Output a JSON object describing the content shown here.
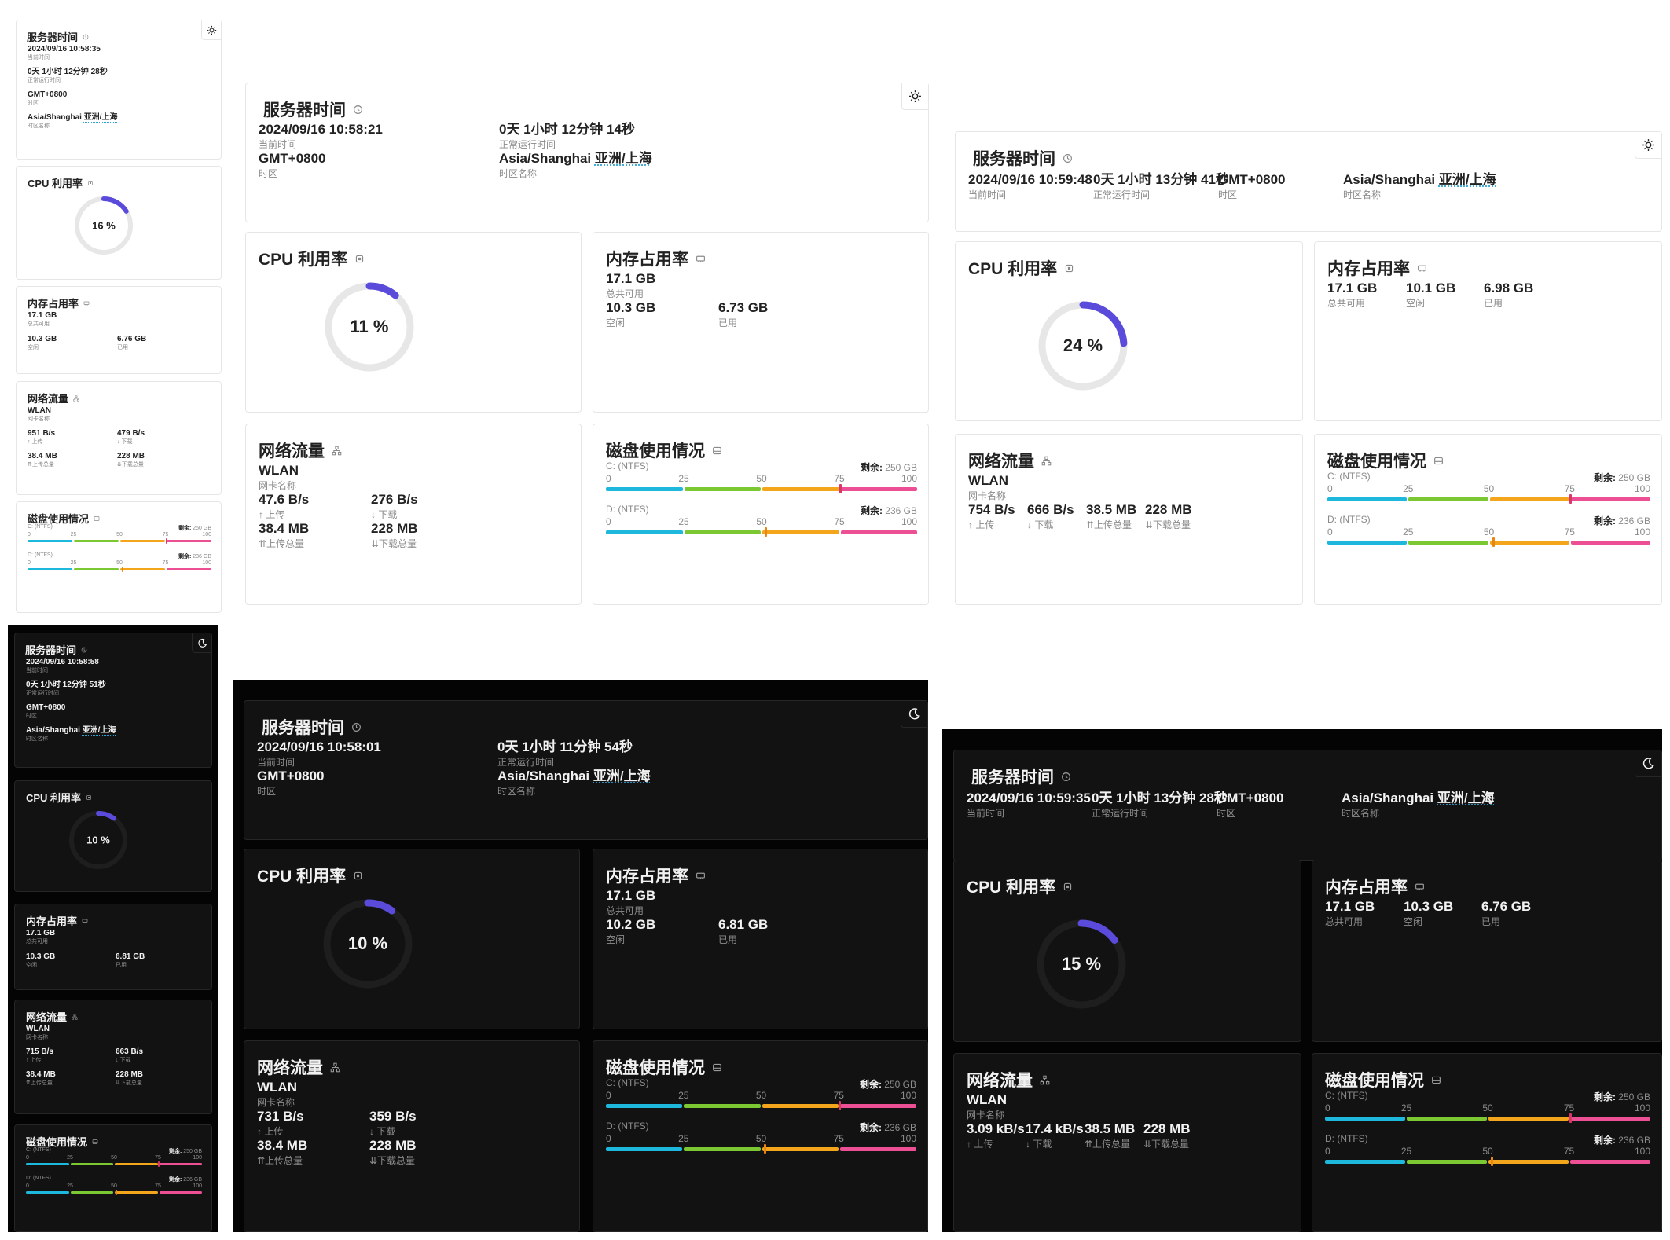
{
  "colors": {
    "accent": "#5b4bdb",
    "track_light": "#e7e7e7",
    "track_dark": "#1e1e1e",
    "seg1": "#1eb8dc",
    "seg2": "#7cc832",
    "seg3": "#f3a51c",
    "seg4": "#ec4f94"
  },
  "labels": {
    "server_time": "服务器时间",
    "current_time": "当前时间",
    "uptime": "正常运行时间",
    "timezone": "时区",
    "tz_name": "时区名称",
    "tz_city": "Asia/Shanghai",
    "tz_cn": "亚洲/上海",
    "cpu": "CPU 利用率",
    "mem": "内存占用率",
    "mem_total": "总共可用",
    "mem_free": "空闲",
    "mem_used": "已用",
    "net": "网络流量",
    "nic": "网卡名称",
    "nic_name": "WLAN",
    "up": "↑ 上传",
    "down": "↓ 下载",
    "up_total": "⇈上传总量",
    "down_total": "⇊下载总量",
    "disk": "磁盘使用情况",
    "disk_c": "C: (NTFS)",
    "disk_d": "D: (NTFS)",
    "remain": "剩余:",
    "disk_c_free": "250 GB",
    "disk_d_free": "236 GB",
    "ticks": [
      "0",
      "25",
      "50",
      "75",
      "100"
    ]
  },
  "icons": {
    "server_time": "clock-icon",
    "cpu": "cpu-icon",
    "mem": "memory-icon",
    "net": "network-icon",
    "disk": "disk-icon",
    "theme_light": "sun-icon",
    "theme_dark": "moon-icon"
  },
  "panels": [
    {
      "theme": "light",
      "time": "2024/09/16 10:58:35",
      "uptime": "0天 1小时 12分钟 28秒",
      "gmt": "GMT+0800",
      "cpu": 16,
      "mem_total": "17.1 GB",
      "mem_free": "10.3 GB",
      "mem_used": "6.76 GB",
      "up": "951 B/s",
      "down": "479 B/s",
      "up_total": "38.4 MB",
      "down_total": "228 MB",
      "disk_c_pct": 75.5,
      "disk_d_pct": 51.5
    },
    {
      "theme": "light",
      "time": "2024/09/16 10:58:21",
      "uptime": "0天 1小时 12分钟 14秒",
      "gmt": "GMT+0800",
      "cpu": 11,
      "mem_total": "17.1 GB",
      "mem_free": "10.3 GB",
      "mem_used": "6.73 GB",
      "up": "47.6 B/s",
      "down": "276 B/s",
      "up_total": "38.4 MB",
      "down_total": "228 MB",
      "disk_c_pct": 75.5,
      "disk_d_pct": 51.5
    },
    {
      "theme": "light",
      "time": "2024/09/16 10:59:48",
      "uptime": "0天 1小时 13分钟 41秒",
      "gmt": "GMT+0800",
      "cpu": 24,
      "mem_total": "17.1 GB",
      "mem_free": "10.1 GB",
      "mem_used": "6.98 GB",
      "up": "754 B/s",
      "down": "666 B/s",
      "up_total": "38.5 MB",
      "down_total": "228 MB",
      "disk_c_pct": 75.5,
      "disk_d_pct": 51.5
    },
    {
      "theme": "dark",
      "time": "2024/09/16 10:58:58",
      "uptime": "0天 1小时 12分钟 51秒",
      "gmt": "GMT+0800",
      "cpu": 10,
      "mem_total": "17.1 GB",
      "mem_free": "10.3 GB",
      "mem_used": "6.81 GB",
      "up": "715 B/s",
      "down": "663 B/s",
      "up_total": "38.4 MB",
      "down_total": "228 MB",
      "disk_c_pct": 75.5,
      "disk_d_pct": 51.5
    },
    {
      "theme": "dark",
      "time": "2024/09/16 10:58:01",
      "uptime": "0天 1小时 11分钟 54秒",
      "gmt": "GMT+0800",
      "cpu": 10,
      "mem_total": "17.1 GB",
      "mem_free": "10.2 GB",
      "mem_used": "6.81 GB",
      "up": "731 B/s",
      "down": "359 B/s",
      "up_total": "38.4 MB",
      "down_total": "228 MB",
      "disk_c_pct": 75.5,
      "disk_d_pct": 51.5
    },
    {
      "theme": "dark",
      "time": "2024/09/16 10:59:35",
      "uptime": "0天 1小时 13分钟 28秒",
      "gmt": "GMT+0800",
      "cpu": 15,
      "mem_total": "17.1 GB",
      "mem_free": "10.3 GB",
      "mem_used": "6.76 GB",
      "up": "3.09 kB/s",
      "down": "17.4 kB/s",
      "up_total": "38.5 MB",
      "down_total": "228 MB",
      "disk_c_pct": 75.5,
      "disk_d_pct": 51.5
    }
  ]
}
